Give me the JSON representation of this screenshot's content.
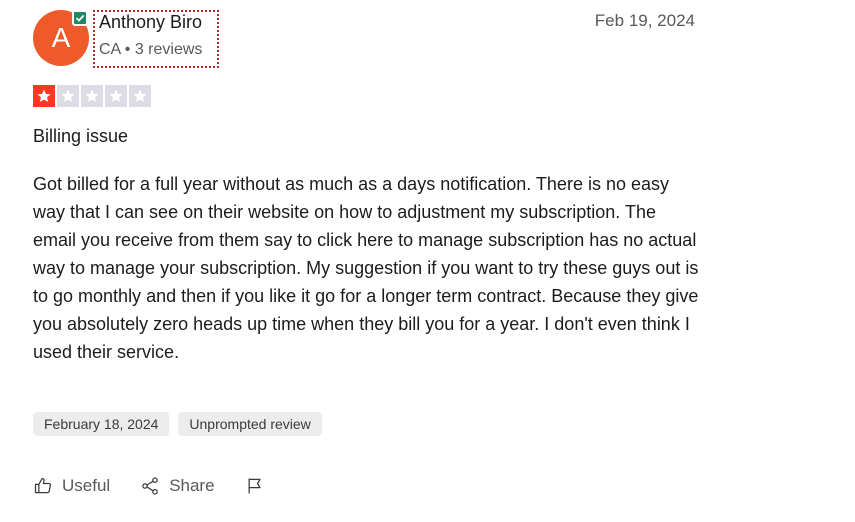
{
  "author": {
    "initial": "A",
    "name": "Anthony Biro",
    "meta": "CA • 3 reviews",
    "verified_icon": "check-icon"
  },
  "date_posted": "Feb 19, 2024",
  "rating": {
    "value": 1,
    "max": 5,
    "filled_color": "#ff3722",
    "empty_color": "#dcdce6"
  },
  "review": {
    "title": "Billing issue",
    "body": "Got billed for a full year without as much as a days notification. There is no easy way that I can see on their website on how to adjustment my subscription. The email you receive from them say to click here to manage subscription has no actual way to manage your subscription. My suggestion if you want to try these guys out is to go monthly and then if you like it go for a longer term contract. Because they give you absolutely zero heads up time when they bill you for a year. I don't even think I used their service."
  },
  "tags": {
    "experience_date": "February 18, 2024",
    "review_type": "Unprompted review"
  },
  "actions": {
    "useful": "Useful",
    "share": "Share"
  },
  "colors": {
    "avatar": "#ef5a2a",
    "verified": "#1f8a62",
    "focus_outline": "#b52a2a"
  }
}
